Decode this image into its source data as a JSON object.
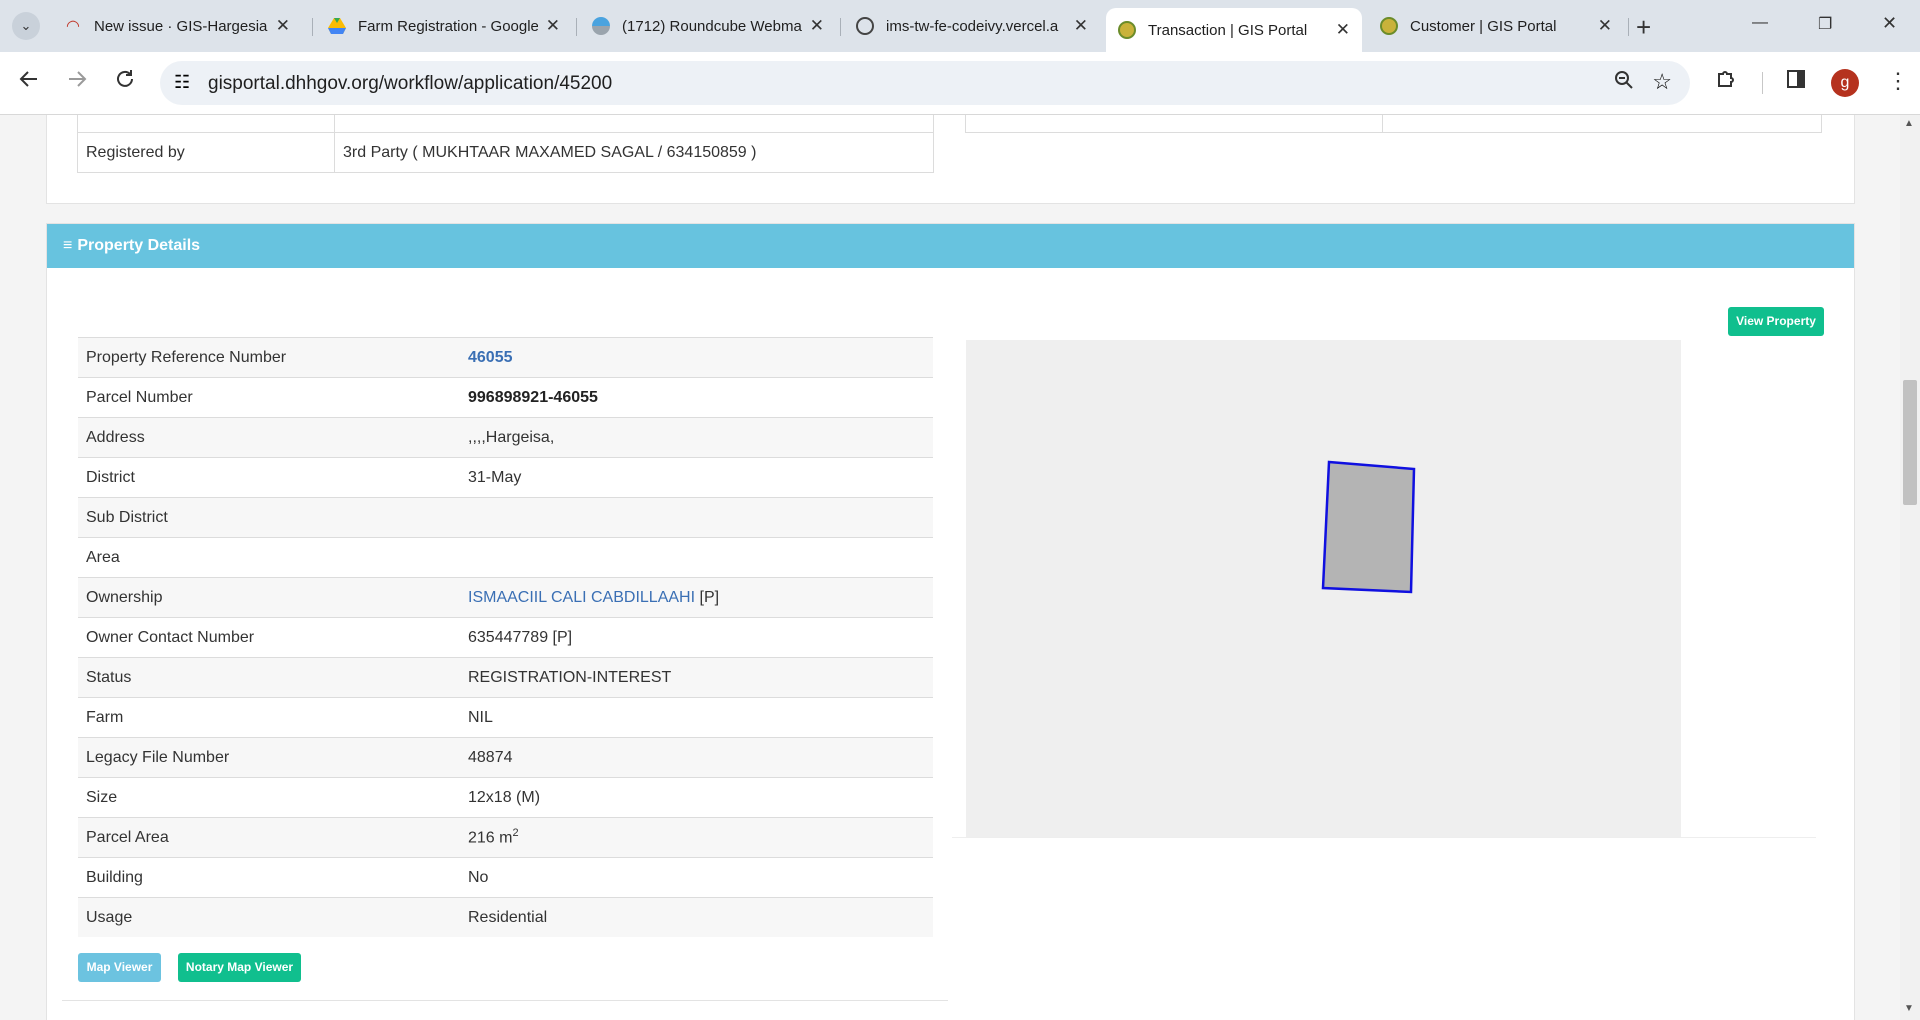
{
  "browser": {
    "tabs": [
      {
        "title": "New issue · GIS-Hargesia",
        "close": "✕"
      },
      {
        "title": "Farm Registration - Google",
        "close": "✕"
      },
      {
        "title": "(1712) Roundcube Webmail",
        "close": "✕"
      },
      {
        "title": "ims-tw-fe-codeivy.vercel.a",
        "close": "✕"
      },
      {
        "title": "Transaction | GIS Portal",
        "close": "✕"
      },
      {
        "title": "Customer | GIS Portal",
        "close": "✕"
      }
    ],
    "new_tab": "+",
    "url": "gisportal.dhhgov.org/workflow/application/45200",
    "avatar_letter": "g",
    "window": {
      "minimize": "—",
      "restore": "❐",
      "close": "✕"
    },
    "icons": {
      "back": "arrow-left",
      "forward": "arrow-right",
      "reload": "reload",
      "zoom": "magnifier",
      "bookmark": "star",
      "extensions": "puzzle",
      "sidepanel": "side-panel",
      "menu": "kebab"
    }
  },
  "registration": {
    "label": "Registered by",
    "value": "3rd Party ( MUKHTAAR MAXAMED SAGAL / 634150859 )"
  },
  "property": {
    "heading": "Property Details",
    "heading_icon": "≡",
    "view_button": "View Property",
    "rows": [
      {
        "label": "Property Reference Number",
        "value": "46055"
      },
      {
        "label": "Parcel Number",
        "value": "996898921-46055"
      },
      {
        "label": "Address",
        "value": ",,,,Hargeisa,"
      },
      {
        "label": "District",
        "value": "31-May"
      },
      {
        "label": "Sub District",
        "value": ""
      },
      {
        "label": "Area",
        "value": ""
      },
      {
        "label": "Ownership",
        "value": "ISMAACIIL CALI CABDILLAAHI",
        "suffix": "[P]"
      },
      {
        "label": "Owner Contact Number",
        "value": "635447789 [P]"
      },
      {
        "label": "Status",
        "value": "REGISTRATION-INTEREST"
      },
      {
        "label": "Farm",
        "value": "NIL"
      },
      {
        "label": "Legacy File Number",
        "value": "48874"
      },
      {
        "label": "Size",
        "value": "12x18 (M)"
      },
      {
        "label": "Parcel Area",
        "value": "216 m",
        "sup": "2"
      },
      {
        "label": "Building",
        "value": "No"
      },
      {
        "label": "Usage",
        "value": "Residential"
      }
    ],
    "map_viewer_button": "Map Viewer",
    "notary_map_button": "Notary Map Viewer"
  },
  "colors": {
    "header_bar": "#67c3df",
    "primary_button": "#10bf8e",
    "info_button": "#6cc3e0",
    "parcel_fill": "#b4b4b4",
    "parcel_stroke": "#1010e0",
    "map_bg": "#efefef"
  }
}
